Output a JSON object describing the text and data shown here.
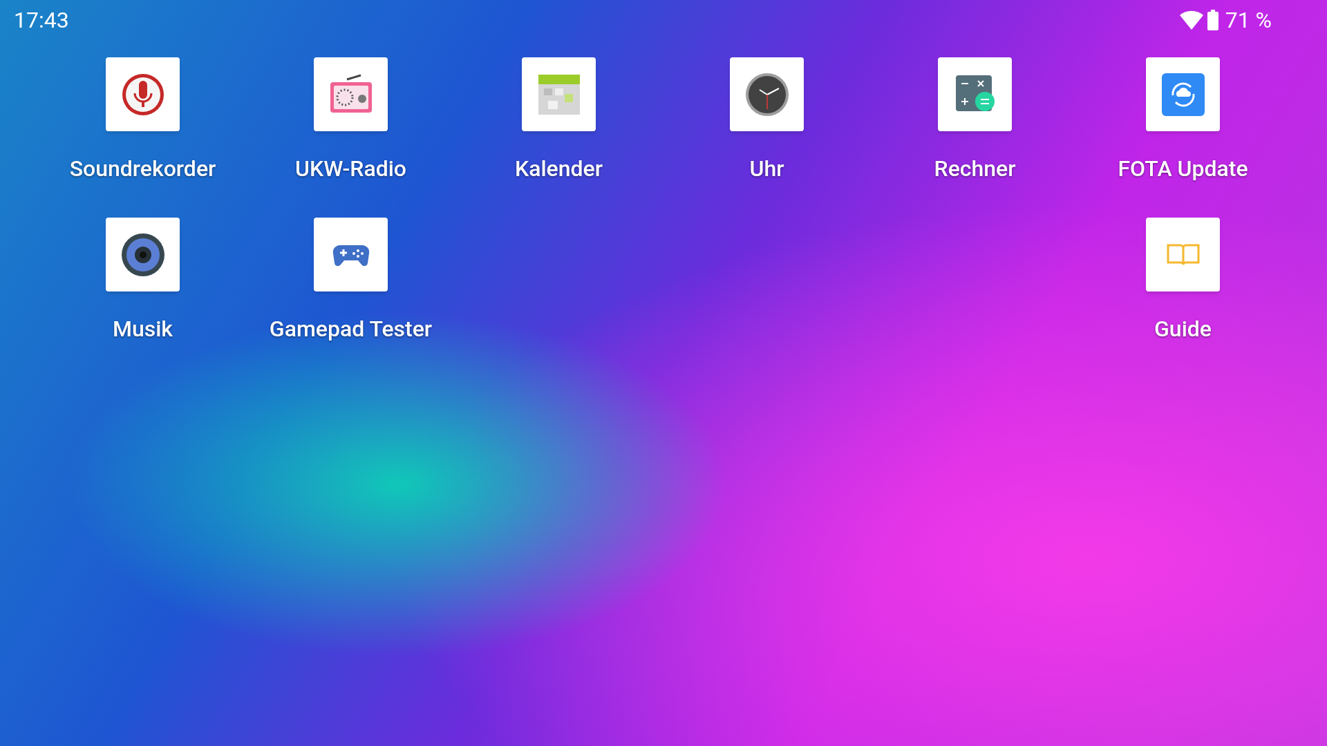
{
  "status_bar": {
    "time": "17:43",
    "battery": "71 %"
  },
  "home_rows": [
    {
      "items": [
        {
          "kind": "app",
          "label": "Soundrekorder"
        },
        {
          "kind": "app",
          "label": "UKW-Radio"
        },
        {
          "kind": "app",
          "label": "Kalender"
        },
        {
          "kind": "app",
          "label": "Uhr"
        },
        {
          "kind": "app",
          "label": "Rechner"
        },
        {
          "kind": "app",
          "label": "FOTA Update"
        }
      ]
    },
    {
      "items": [
        {
          "kind": "app",
          "label": "Musik"
        },
        {
          "kind": "app",
          "label": "Gamepad Tester"
        },
        {
          "kind": "empty"
        },
        {
          "kind": "empty"
        },
        {
          "kind": "empty"
        },
        {
          "kind": "app",
          "label": "Guide"
        }
      ]
    }
  ]
}
